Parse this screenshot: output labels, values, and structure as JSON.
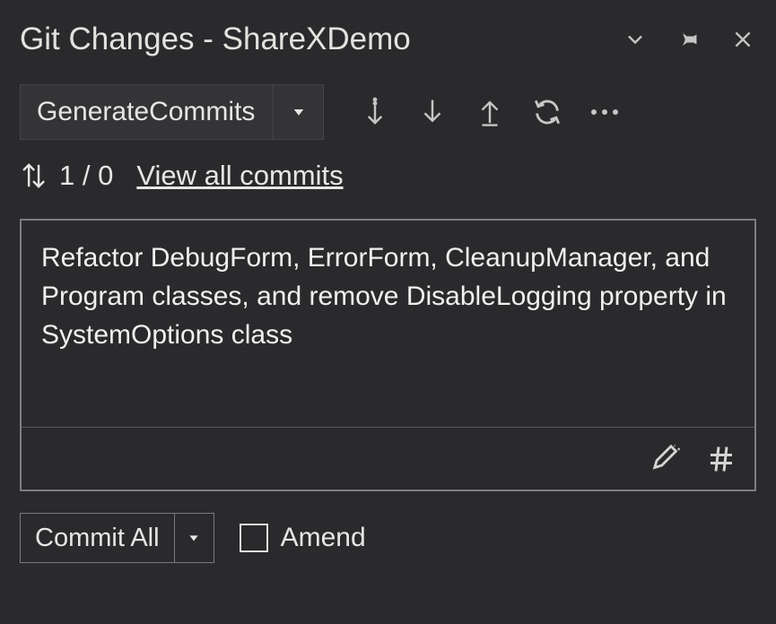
{
  "title": "Git Changes - ShareXDemo",
  "branch": {
    "name": "GenerateCommits"
  },
  "counts": {
    "text": "1 / 0"
  },
  "links": {
    "view_all": "View all commits"
  },
  "commit_message": "Refactor DebugForm, ErrorForm, CleanupManager, and Program classes, and remove DisableLogging property in SystemOptions class",
  "buttons": {
    "commit_all": "Commit All",
    "amend": "Amend"
  },
  "amend_checked": false
}
